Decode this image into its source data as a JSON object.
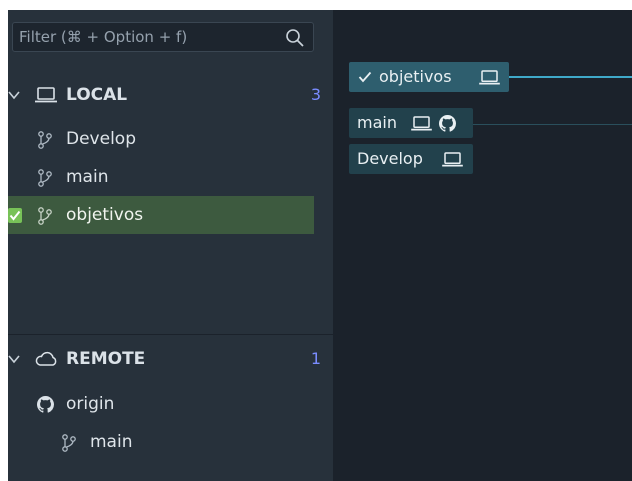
{
  "filter": {
    "placeholder": "Filter (⌘ + Option + f)",
    "icon": "search-icon"
  },
  "local": {
    "title": "LOCAL",
    "count": "3",
    "icon": "laptop-icon",
    "branches": [
      {
        "name": "Develop",
        "checked": false
      },
      {
        "name": "main",
        "checked": false
      },
      {
        "name": "objetivos",
        "checked": true
      }
    ]
  },
  "remote": {
    "title": "REMOTE",
    "count": "1",
    "icon": "cloud-icon",
    "origin": "origin",
    "branches": [
      {
        "name": "main"
      }
    ]
  },
  "graph": {
    "head_label": "objetivos",
    "labels": [
      {
        "name": "main"
      },
      {
        "name": "Develop"
      }
    ]
  },
  "colors": {
    "accent_count": "#7a8cff",
    "selected_row": "#3d5a3f",
    "checkbox": "#78c258",
    "branch_tag": "#2e5e6e",
    "graph_line": "#3fa9c9"
  }
}
